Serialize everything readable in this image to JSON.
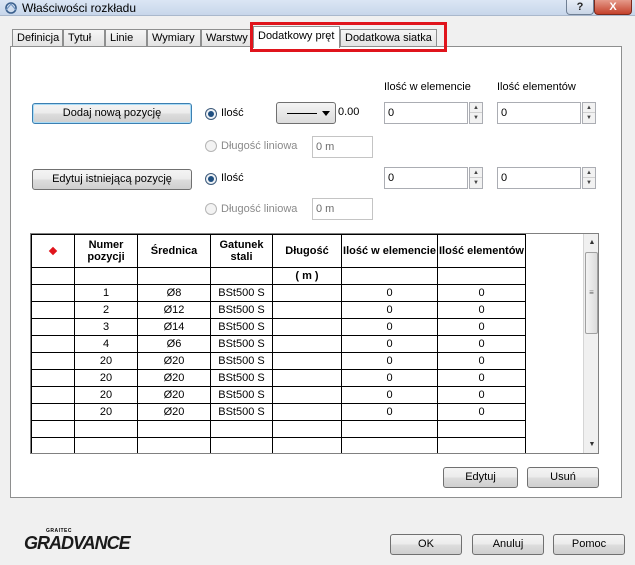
{
  "window": {
    "title": "Właściwości rozkładu",
    "help_label": "?",
    "close_label": "X"
  },
  "tabs": [
    {
      "label": "Definicja"
    },
    {
      "label": "Tytuł"
    },
    {
      "label": "Linie"
    },
    {
      "label": "Wymiary"
    },
    {
      "label": "Warstwy"
    },
    {
      "label": "Dodatkowy pręt"
    },
    {
      "label": "Dodatkowa siatka"
    }
  ],
  "active_tab": "Dodatkowy pręt",
  "colors": {
    "highlight": "#e0141c",
    "marker": "#e0141c"
  },
  "form": {
    "header_ilosc_w_elemencie": "Ilość w elemencie",
    "header_ilosc_elementow": "Ilość elementów",
    "add_position_button": "Dodaj nową pozycję",
    "edit_position_button": "Edytuj istniejącą pozycję",
    "add": {
      "radio_ilosc": "Ilość",
      "radio_dlugosc": "Długość liniowa",
      "line_value": "0.00",
      "dlugosc_value": "0 m",
      "ilosc_w_elemencie": "0",
      "ilosc_elementow": "0"
    },
    "edit": {
      "radio_ilosc": "Ilość",
      "radio_dlugosc": "Długość liniowa",
      "dlugosc_value": "0 m",
      "ilosc_w_elemencie": "0",
      "ilosc_elementow": "0"
    }
  },
  "table": {
    "columns": [
      "Numer pozycji",
      "Średnica",
      "Gatunek stali",
      "Długość",
      "Ilość w elemencie",
      "Ilość elementów"
    ],
    "unit_row": [
      "",
      "",
      "",
      "( m )",
      "",
      ""
    ],
    "rows": [
      [
        "1",
        "Ø8",
        "BSt500 S",
        "",
        "0",
        "0"
      ],
      [
        "2",
        "Ø12",
        "BSt500 S",
        "",
        "0",
        "0"
      ],
      [
        "3",
        "Ø14",
        "BSt500 S",
        "",
        "0",
        "0"
      ],
      [
        "4",
        "Ø6",
        "BSt500 S",
        "",
        "0",
        "0"
      ],
      [
        "20",
        "Ø20",
        "BSt500 S",
        "",
        "0",
        "0"
      ],
      [
        "20",
        "Ø20",
        "BSt500 S",
        "",
        "0",
        "0"
      ],
      [
        "20",
        "Ø20",
        "BSt500 S",
        "",
        "0",
        "0"
      ],
      [
        "20",
        "Ø20",
        "BSt500 S",
        "",
        "0",
        "0"
      ],
      [
        "",
        "",
        "",
        "",
        "",
        ""
      ],
      [
        "",
        "",
        "",
        "",
        "",
        ""
      ]
    ]
  },
  "table_buttons": {
    "edit": "Edytuj",
    "delete": "Usuń"
  },
  "footer": {
    "logo_small": "GRAITEC",
    "logo_big": "GRADVANCE",
    "ok": "OK",
    "cancel": "Anuluj",
    "help": "Pomoc"
  }
}
